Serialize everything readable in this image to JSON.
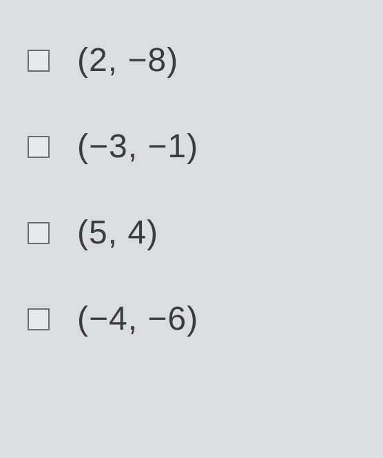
{
  "options": [
    {
      "label": "(2, −8)"
    },
    {
      "label": "(−3, −1)"
    },
    {
      "label": "(5, 4)"
    },
    {
      "label": "(−4, −6)"
    }
  ]
}
